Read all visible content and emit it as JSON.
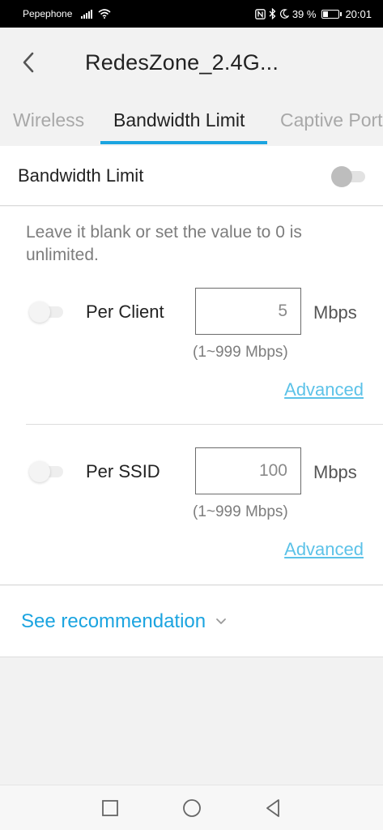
{
  "status_bar": {
    "carrier": "Pepephone",
    "battery": "39 %",
    "time": "20:01",
    "icons": [
      "signal-icon",
      "wifi-icon",
      "nfc-icon",
      "bluetooth-icon",
      "moon-icon",
      "battery-icon"
    ]
  },
  "header": {
    "title": "RedesZone_2.4G..."
  },
  "tabs": [
    {
      "label": "Wireless",
      "active": false
    },
    {
      "label": "Bandwidth Limit",
      "active": true
    },
    {
      "label": "Captive Portal",
      "active": false
    }
  ],
  "bandwidth_limit": {
    "label": "Bandwidth Limit",
    "enabled": false
  },
  "settings": {
    "hint": "Leave it blank or set the value to 0 is unlimited.",
    "per_client": {
      "label": "Per Client",
      "value": "5",
      "unit": "Mbps",
      "range": "(1~999 Mbps)",
      "advanced": "Advanced",
      "enabled": false
    },
    "per_ssid": {
      "label": "Per SSID",
      "value": "100",
      "unit": "Mbps",
      "range": "(1~999 Mbps)",
      "advanced": "Advanced",
      "enabled": false
    }
  },
  "recommendation": {
    "label": "See recommendation"
  },
  "colors": {
    "accent": "#1ba4e0",
    "link": "#5cc2e8",
    "background": "#f2f2f2"
  }
}
